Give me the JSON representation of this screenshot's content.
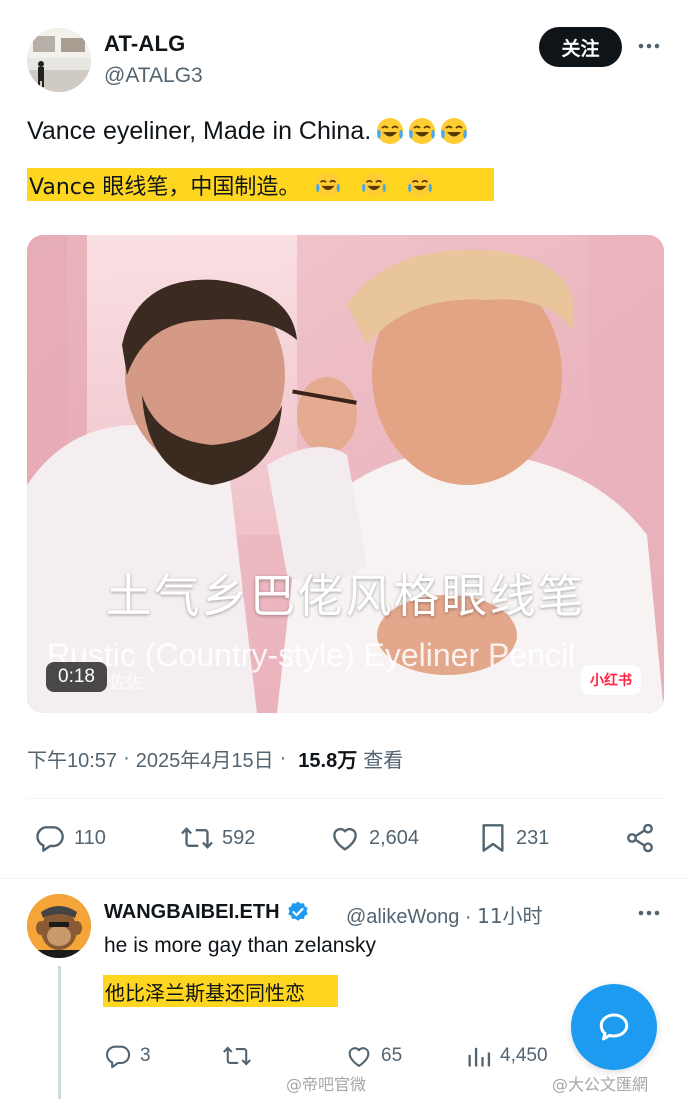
{
  "author": {
    "name": "AT-ALG",
    "handle": "@ATALG3",
    "follow_label": "关注"
  },
  "tweet": {
    "text": "Vance eyeliner, Made in China.",
    "translation": "Vance 眼线笔，中国制造。",
    "emoji": "face-with-tears-of-joy"
  },
  "media": {
    "subtitle_cn": "土气乡巴佬风格眼线笔",
    "subtitle_en": "Rustic (Country-style) Eyeliner Pencil",
    "duration": "0:18",
    "watermark_left": "佐佐",
    "watermark_badge": "小红书"
  },
  "meta": {
    "time": "下午10:57",
    "date": "2025年4月15日",
    "views": "15.8万",
    "views_label": "查看"
  },
  "actions": {
    "replies": "110",
    "reposts": "592",
    "likes": "2,604",
    "bookmarks": "231"
  },
  "reply": {
    "name": "WANGBAIBEI.ETH",
    "handle": "@alikeWong",
    "time": "11小时",
    "text": "he is more gay than zelansky",
    "translation": "他比泽兰斯基还同性恋",
    "replies": "3",
    "likes": "65",
    "views": "4,450"
  },
  "watermarks": {
    "left": "@帝吧官微",
    "right": "@大公文匯網"
  },
  "colors": {
    "highlight": "#ffd61f",
    "accent": "#1d9bf0",
    "secondary_text": "#536471",
    "primary_text": "#0f1419"
  }
}
